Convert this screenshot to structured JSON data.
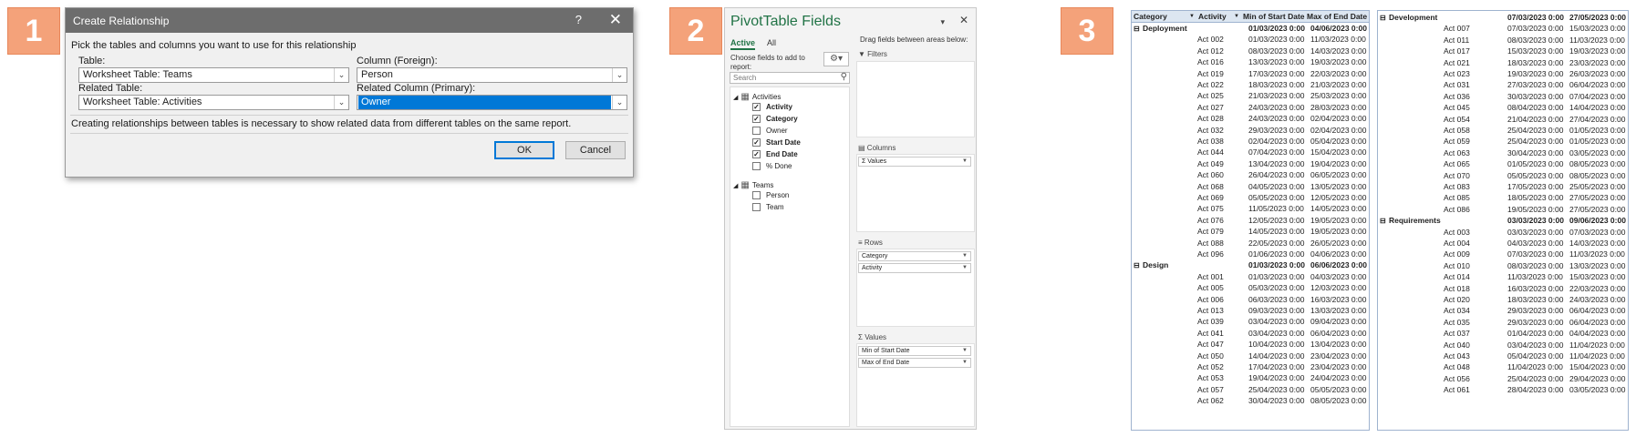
{
  "badges": [
    "1",
    "2",
    "3"
  ],
  "dialog": {
    "title": "Create Relationship",
    "help_glyph": "?",
    "close_glyph": "✕",
    "instruction": "Pick the tables and columns you want to use for this relationship",
    "table_label": "Table:",
    "table_value": "Worksheet Table: Teams",
    "column_foreign_label": "Column (Foreign):",
    "column_foreign_value": "Person",
    "related_table_label": "Related Table:",
    "related_table_value": "Worksheet Table: Activities",
    "related_column_label": "Related Column (Primary):",
    "related_column_value": "Owner",
    "info": "Creating relationships between tables is necessary to show related data from different tables on the same report.",
    "ok_label": "OK",
    "cancel_label": "Cancel",
    "accent_color": "#0078d7"
  },
  "pivot_fields": {
    "title": "PivotTable Fields",
    "tabs": [
      "Active",
      "All"
    ],
    "choose_text": "Choose fields to add to report:",
    "drag_text": "Drag fields between areas below:",
    "search_placeholder": "Search",
    "tables": [
      {
        "name": "Activities",
        "fields": [
          {
            "label": "Activity",
            "checked": true
          },
          {
            "label": "Category",
            "checked": true
          },
          {
            "label": "Owner",
            "checked": false
          },
          {
            "label": "Start Date",
            "checked": true
          },
          {
            "label": "End Date",
            "checked": true
          },
          {
            "label": "% Done",
            "checked": false
          }
        ]
      },
      {
        "name": "Teams",
        "fields": [
          {
            "label": "Person",
            "checked": false
          },
          {
            "label": "Team",
            "checked": false
          }
        ]
      }
    ],
    "areas": {
      "filters": "Filters",
      "columns": "Columns",
      "columns_items": [
        "Values"
      ],
      "rows": "Rows",
      "rows_items": [
        "Category",
        "Activity"
      ],
      "values": "Values",
      "values_items": [
        "Min of Start Date",
        "Max of End Date"
      ]
    },
    "accent_color": "#217346"
  },
  "pivot_table": {
    "headers": [
      "Category",
      "Activity",
      "Min of Start Date",
      "Max of End Date"
    ],
    "left_rows": [
      {
        "g": true,
        "a": "Deployment",
        "s": "01/03/2023 0:00",
        "e": "04/06/2023 0:00"
      },
      {
        "a": "Act 002",
        "s": "01/03/2023 0:00",
        "e": "11/03/2023 0:00"
      },
      {
        "a": "Act 012",
        "s": "08/03/2023 0:00",
        "e": "14/03/2023 0:00"
      },
      {
        "a": "Act 016",
        "s": "13/03/2023 0:00",
        "e": "19/03/2023 0:00"
      },
      {
        "a": "Act 019",
        "s": "17/03/2023 0:00",
        "e": "22/03/2023 0:00"
      },
      {
        "a": "Act 022",
        "s": "18/03/2023 0:00",
        "e": "21/03/2023 0:00"
      },
      {
        "a": "Act 025",
        "s": "21/03/2023 0:00",
        "e": "25/03/2023 0:00"
      },
      {
        "a": "Act 027",
        "s": "24/03/2023 0:00",
        "e": "28/03/2023 0:00"
      },
      {
        "a": "Act 028",
        "s": "24/03/2023 0:00",
        "e": "02/04/2023 0:00"
      },
      {
        "a": "Act 032",
        "s": "29/03/2023 0:00",
        "e": "02/04/2023 0:00"
      },
      {
        "a": "Act 038",
        "s": "02/04/2023 0:00",
        "e": "05/04/2023 0:00"
      },
      {
        "a": "Act 044",
        "s": "07/04/2023 0:00",
        "e": "15/04/2023 0:00"
      },
      {
        "a": "Act 049",
        "s": "13/04/2023 0:00",
        "e": "19/04/2023 0:00"
      },
      {
        "a": "Act 060",
        "s": "26/04/2023 0:00",
        "e": "06/05/2023 0:00"
      },
      {
        "a": "Act 068",
        "s": "04/05/2023 0:00",
        "e": "13/05/2023 0:00"
      },
      {
        "a": "Act 069",
        "s": "05/05/2023 0:00",
        "e": "12/05/2023 0:00"
      },
      {
        "a": "Act 075",
        "s": "11/05/2023 0:00",
        "e": "14/05/2023 0:00"
      },
      {
        "a": "Act 076",
        "s": "12/05/2023 0:00",
        "e": "19/05/2023 0:00"
      },
      {
        "a": "Act 079",
        "s": "14/05/2023 0:00",
        "e": "19/05/2023 0:00"
      },
      {
        "a": "Act 088",
        "s": "22/05/2023 0:00",
        "e": "26/05/2023 0:00"
      },
      {
        "a": "Act 096",
        "s": "01/06/2023 0:00",
        "e": "04/06/2023 0:00"
      },
      {
        "g": true,
        "a": "Design",
        "s": "01/03/2023 0:00",
        "e": "06/06/2023 0:00"
      },
      {
        "a": "Act 001",
        "s": "01/03/2023 0:00",
        "e": "04/03/2023 0:00"
      },
      {
        "a": "Act 005",
        "s": "05/03/2023 0:00",
        "e": "12/03/2023 0:00"
      },
      {
        "a": "Act 006",
        "s": "06/03/2023 0:00",
        "e": "16/03/2023 0:00"
      },
      {
        "a": "Act 013",
        "s": "09/03/2023 0:00",
        "e": "13/03/2023 0:00"
      },
      {
        "a": "Act 039",
        "s": "03/04/2023 0:00",
        "e": "09/04/2023 0:00"
      },
      {
        "a": "Act 041",
        "s": "03/04/2023 0:00",
        "e": "06/04/2023 0:00"
      },
      {
        "a": "Act 047",
        "s": "10/04/2023 0:00",
        "e": "13/04/2023 0:00"
      },
      {
        "a": "Act 050",
        "s": "14/04/2023 0:00",
        "e": "23/04/2023 0:00"
      },
      {
        "a": "Act 052",
        "s": "17/04/2023 0:00",
        "e": "23/04/2023 0:00"
      },
      {
        "a": "Act 053",
        "s": "19/04/2023 0:00",
        "e": "24/04/2023 0:00"
      },
      {
        "a": "Act 057",
        "s": "25/04/2023 0:00",
        "e": "05/05/2023 0:00"
      },
      {
        "a": "Act 062",
        "s": "30/04/2023 0:00",
        "e": "08/05/2023 0:00"
      }
    ],
    "right_rows": [
      {
        "g": true,
        "a": "Development",
        "s": "07/03/2023 0:00",
        "e": "27/05/2023 0:00"
      },
      {
        "a": "Act 007",
        "s": "07/03/2023 0:00",
        "e": "15/03/2023 0:00"
      },
      {
        "a": "Act 011",
        "s": "08/03/2023 0:00",
        "e": "11/03/2023 0:00"
      },
      {
        "a": "Act 017",
        "s": "15/03/2023 0:00",
        "e": "19/03/2023 0:00"
      },
      {
        "a": "Act 021",
        "s": "18/03/2023 0:00",
        "e": "23/03/2023 0:00"
      },
      {
        "a": "Act 023",
        "s": "19/03/2023 0:00",
        "e": "26/03/2023 0:00"
      },
      {
        "a": "Act 031",
        "s": "27/03/2023 0:00",
        "e": "06/04/2023 0:00"
      },
      {
        "a": "Act 036",
        "s": "30/03/2023 0:00",
        "e": "07/04/2023 0:00"
      },
      {
        "a": "Act 045",
        "s": "08/04/2023 0:00",
        "e": "14/04/2023 0:00"
      },
      {
        "a": "Act 054",
        "s": "21/04/2023 0:00",
        "e": "27/04/2023 0:00"
      },
      {
        "a": "Act 058",
        "s": "25/04/2023 0:00",
        "e": "01/05/2023 0:00"
      },
      {
        "a": "Act 059",
        "s": "25/04/2023 0:00",
        "e": "01/05/2023 0:00"
      },
      {
        "a": "Act 063",
        "s": "30/04/2023 0:00",
        "e": "03/05/2023 0:00"
      },
      {
        "a": "Act 065",
        "s": "01/05/2023 0:00",
        "e": "08/05/2023 0:00"
      },
      {
        "a": "Act 070",
        "s": "05/05/2023 0:00",
        "e": "08/05/2023 0:00"
      },
      {
        "a": "Act 083",
        "s": "17/05/2023 0:00",
        "e": "25/05/2023 0:00"
      },
      {
        "a": "Act 085",
        "s": "18/05/2023 0:00",
        "e": "27/05/2023 0:00"
      },
      {
        "a": "Act 086",
        "s": "19/05/2023 0:00",
        "e": "27/05/2023 0:00"
      },
      {
        "g": true,
        "a": "Requirements",
        "s": "03/03/2023 0:00",
        "e": "09/06/2023 0:00"
      },
      {
        "a": "Act 003",
        "s": "03/03/2023 0:00",
        "e": "07/03/2023 0:00"
      },
      {
        "a": "Act 004",
        "s": "04/03/2023 0:00",
        "e": "14/03/2023 0:00"
      },
      {
        "a": "Act 009",
        "s": "07/03/2023 0:00",
        "e": "11/03/2023 0:00"
      },
      {
        "a": "Act 010",
        "s": "08/03/2023 0:00",
        "e": "13/03/2023 0:00"
      },
      {
        "a": "Act 014",
        "s": "11/03/2023 0:00",
        "e": "15/03/2023 0:00"
      },
      {
        "a": "Act 018",
        "s": "16/03/2023 0:00",
        "e": "22/03/2023 0:00"
      },
      {
        "a": "Act 020",
        "s": "18/03/2023 0:00",
        "e": "24/03/2023 0:00"
      },
      {
        "a": "Act 034",
        "s": "29/03/2023 0:00",
        "e": "06/04/2023 0:00"
      },
      {
        "a": "Act 035",
        "s": "29/03/2023 0:00",
        "e": "06/04/2023 0:00"
      },
      {
        "a": "Act 037",
        "s": "01/04/2023 0:00",
        "e": "04/04/2023 0:00"
      },
      {
        "a": "Act 040",
        "s": "03/04/2023 0:00",
        "e": "11/04/2023 0:00"
      },
      {
        "a": "Act 043",
        "s": "05/04/2023 0:00",
        "e": "11/04/2023 0:00"
      },
      {
        "a": "Act 048",
        "s": "11/04/2023 0:00",
        "e": "15/04/2023 0:00"
      },
      {
        "a": "Act 056",
        "s": "25/04/2023 0:00",
        "e": "29/04/2023 0:00"
      },
      {
        "a": "Act 061",
        "s": "28/04/2023 0:00",
        "e": "03/05/2023 0:00"
      }
    ]
  }
}
